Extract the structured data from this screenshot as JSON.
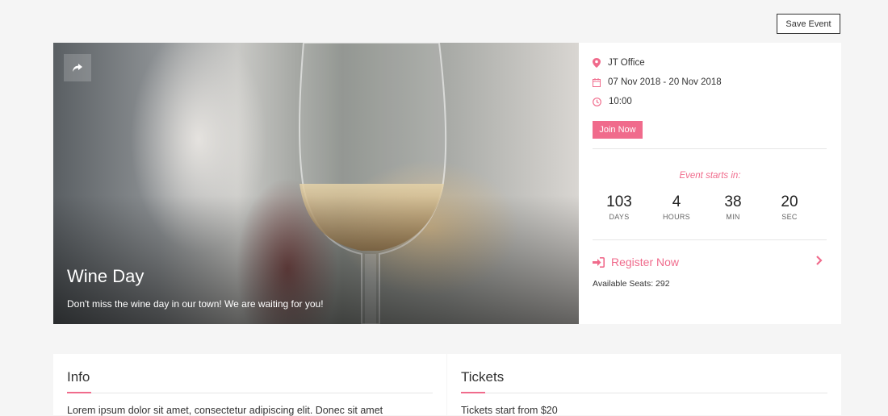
{
  "toolbar": {
    "save_label": "Save Event"
  },
  "hero": {
    "title": "Wine Day",
    "subtitle": "Don't miss the wine day in our town! We are waiting for you!"
  },
  "event": {
    "location": "JT Office",
    "dates": "07 Nov 2018 - 20 Nov 2018",
    "time": "10:00",
    "join_label": "Join Now"
  },
  "countdown": {
    "label": "Event starts in:",
    "items": [
      {
        "value": "103",
        "unit": "DAYS"
      },
      {
        "value": "4",
        "unit": "HOURS"
      },
      {
        "value": "38",
        "unit": "MIN"
      },
      {
        "value": "20",
        "unit": "SEC"
      }
    ]
  },
  "registration": {
    "label": "Register Now",
    "seats": "Available Seats: 292"
  },
  "info": {
    "title": "Info",
    "text": "Lorem ipsum dolor sit amet, consectetur adipiscing elit. Donec sit amet"
  },
  "tickets": {
    "title": "Tickets",
    "text": "Tickets start from $20"
  },
  "colors": {
    "accent": "#f06b8c",
    "background": "#f5f5f5"
  },
  "icons": [
    "share-icon",
    "map-marker-icon",
    "calendar-icon",
    "clock-icon",
    "sign-in-icon",
    "chevron-right-icon"
  ]
}
